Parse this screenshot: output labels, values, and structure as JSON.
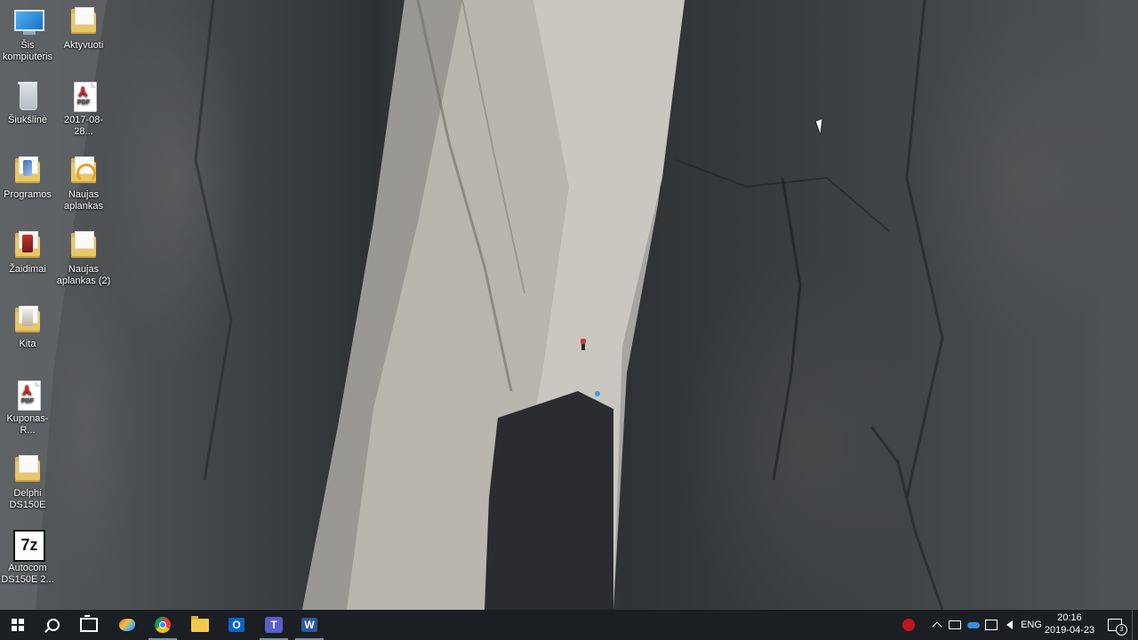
{
  "desktop": {
    "icons": [
      {
        "label": "Šis kompiuteris",
        "icon": "computer-icon"
      },
      {
        "label": "Aktyvuoti",
        "icon": "folder-icon"
      },
      {
        "label": "Šiukšlinė",
        "icon": "recycle-bin-icon"
      },
      {
        "label": "2017-08-28...",
        "icon": "pdf-icon"
      },
      {
        "label": "Programos",
        "icon": "folder-icon"
      },
      {
        "label": "Naujas aplankas",
        "icon": "headphones-folder-icon"
      },
      {
        "label": "Žaidimai",
        "icon": "folder-icon"
      },
      {
        "label": "Naujas aplankas (2)",
        "icon": "folder-icon"
      },
      {
        "label": "Kita",
        "icon": "folder-icon"
      },
      {
        "label": "Kuponas-R...",
        "icon": "pdf-icon"
      },
      {
        "label": "Delphi DS150E",
        "icon": "folder-icon"
      },
      {
        "label": "Autocom DS150E 2...",
        "icon": "7zip-archive-icon"
      }
    ]
  },
  "taskbar": {
    "start": "start-icon",
    "search": "search-icon",
    "task_view": "task-view-icon",
    "apps": [
      {
        "name": "paint",
        "icon": "paint-icon"
      },
      {
        "name": "chrome",
        "icon": "chrome-icon"
      },
      {
        "name": "file-explorer",
        "icon": "file-explorer-icon"
      },
      {
        "name": "outlook",
        "icon": "outlook-icon",
        "glyph": "O"
      },
      {
        "name": "teams",
        "icon": "teams-icon",
        "glyph": "T"
      },
      {
        "name": "word",
        "icon": "word-icon",
        "glyph": "W"
      }
    ],
    "tray": {
      "language": "ENG",
      "time": "20:16",
      "date": "2019-04-23",
      "notification_count": "3"
    }
  }
}
